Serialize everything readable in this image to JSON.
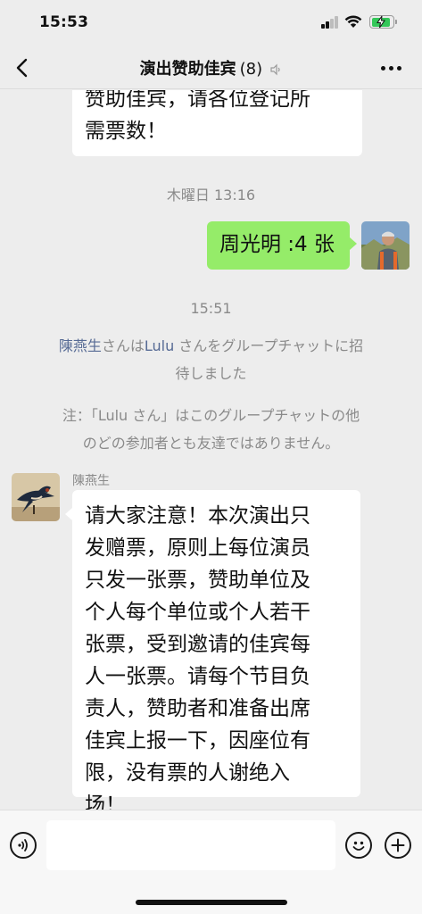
{
  "status_bar": {
    "time": "15:53",
    "battery_color": "#34c759",
    "icons": [
      "signal-icon",
      "wifi-icon",
      "battery-charging-icon"
    ]
  },
  "header": {
    "title": "演出赞助佳宾",
    "member_count": "(8)",
    "icons": [
      "back-icon",
      "mute-icon",
      "more-icon"
    ]
  },
  "messages": [
    {
      "type": "incoming_text",
      "lines": [
        "赞助佳宾，请各位登记所",
        "需票数！"
      ]
    },
    {
      "type": "timestamp",
      "text": "木曜日 13:16"
    },
    {
      "type": "outgoing_text",
      "text": "周光明 :4 张",
      "bubble_color": "#95ec69"
    },
    {
      "type": "timestamp",
      "text": "15:51"
    },
    {
      "type": "system",
      "inviter": "陳燕生",
      "part1": "さんは",
      "invitee": "Lulu",
      "part2": " さんをグループチャットに招",
      "line2": "待しました"
    },
    {
      "type": "system_note",
      "line1": "注：「Lulu さん」はこのグループチャットの他",
      "line2": "のどの参加者とも友達ではありません。"
    },
    {
      "type": "incoming_text",
      "sender": "陳燕生",
      "lines": [
        "请大家注意！本次演出只",
        "发赠票，原则上每位演员",
        "只发一张票，赞助单位及",
        "个人每个单位或个人若干",
        "张票，受到邀请的佳宾每",
        "人一张票。请每个节目负",
        "责人，赞助者和准备出席",
        "佳宾上报一下，因座位有",
        "限，没有票的人谢绝入",
        "场！"
      ]
    }
  ],
  "input_bar": {
    "icons": [
      "voice-icon",
      "emoji-icon",
      "plus-icon"
    ]
  },
  "colors": {
    "background": "#ededed",
    "link": "#576b95",
    "outgoing_bubble": "#95ec69"
  }
}
